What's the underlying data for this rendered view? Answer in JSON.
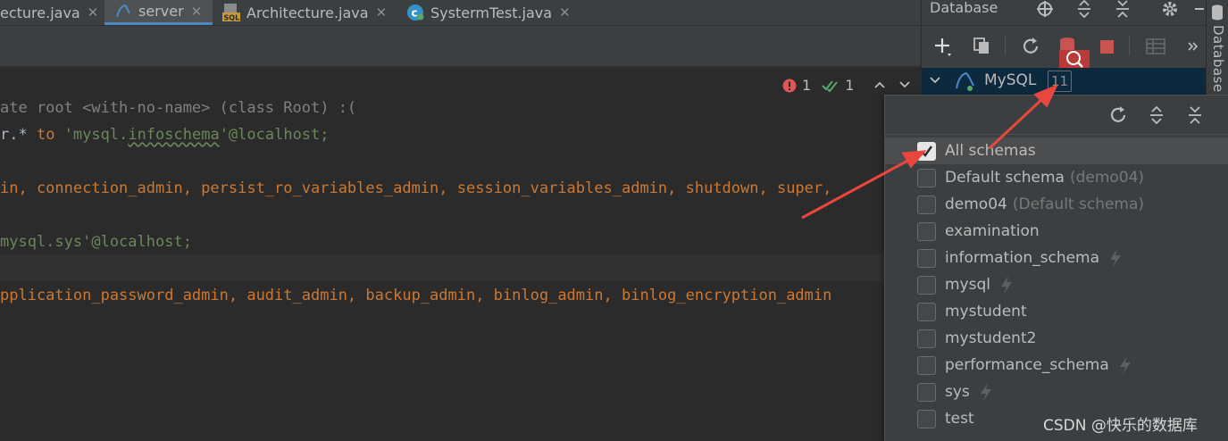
{
  "tabs": [
    {
      "label": "ecture.java",
      "icon": "java-class-icon"
    },
    {
      "label": "server",
      "icon": "mysql-icon",
      "active": true
    },
    {
      "label": "Architecture.java",
      "icon": "sql-file-icon"
    },
    {
      "label": "SystermTest.java",
      "icon": "java-test-icon"
    }
  ],
  "inspection": {
    "errors": "1",
    "checks": "1"
  },
  "code": {
    "line1": "ate root <with-no-name> (class Root) :(",
    "line2_a": "r.* ",
    "line2_to": "to",
    "line2_b": " 'mysql.",
    "line2_schema": "infoschema",
    "line2_c": "'@localhost;",
    "line3": "in, connection_admin, persist_ro_variables_admin, session_variables_admin, shutdown, super,",
    "line4": "mysql.sys'@localhost;",
    "line5": "pplication_password_admin, audit_admin, backup_admin, binlog_admin, binlog_encryption_admin"
  },
  "database_panel": {
    "title": "Database",
    "side_label": "Database",
    "tree": {
      "label": "MySQL",
      "badge": "11"
    }
  },
  "schema_popup": {
    "items": [
      {
        "label": "All schemas",
        "checked": true
      },
      {
        "label": "Default schema",
        "hint": "(demo04)"
      },
      {
        "label": "demo04",
        "hint": " (Default schema)"
      },
      {
        "label": "examination"
      },
      {
        "label": "information_schema",
        "bolt": true
      },
      {
        "label": "mysql",
        "bolt": true
      },
      {
        "label": "mystudent"
      },
      {
        "label": "mystudent2"
      },
      {
        "label": "performance_schema",
        "bolt": true
      },
      {
        "label": "sys",
        "bolt": true
      },
      {
        "label": "test"
      }
    ]
  },
  "watermark": "CSDN @快乐的数据库",
  "colors": {
    "accent": "#4a88c7",
    "annotation_arrow": "#e8473d",
    "keyword": "#cc7832",
    "string": "#6a8759"
  }
}
